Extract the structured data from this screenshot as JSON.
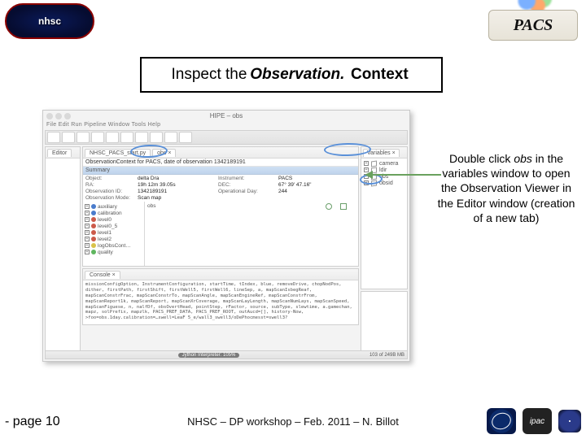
{
  "header": {
    "nhsc": "nhsc",
    "pacs": "PACS"
  },
  "title": {
    "pre": "Inspect the ",
    "em1": "Observation.",
    "em2": "Context"
  },
  "callout": {
    "l1": "Double click ",
    "obs": "obs",
    "l2": " in the variables window to open the Observation Viewer in the Editor window (creation of a new tab)"
  },
  "app": {
    "window_title": "HIPE – obs",
    "menubar": "File  Edit  Run  Pipeline  Window  Tools  Help",
    "left_tab": "Editor",
    "tabs": {
      "a": "NHSC_PACS_start.py",
      "b": "obs ×"
    },
    "summary_hdr": "Summary",
    "obs_title": "ObservationContext for PACS, date of observation 1342189191",
    "fields": {
      "obj_k": "Object:",
      "obj_v": "delta Dra",
      "ra_k": "RA:",
      "ra_v": "19h 12m 39.05s",
      "obsid_k": "Observation ID:",
      "obsid_v": "1342189191",
      "mode_k": "Observation Mode:",
      "mode_v": "Scan map",
      "inst_k": "Instrument:",
      "inst_v": "PACS",
      "dec_k": "DEC:",
      "dec_v": "67° 39' 47.16\"",
      "od_k": "Operational Day:",
      "od_v": "244"
    },
    "tree": {
      "a": "auxiliary",
      "b": "calibration",
      "c": "level0",
      "d": "level0_5",
      "e": "level1",
      "f": "level2",
      "g": "logObsCont…",
      "h": "quality"
    },
    "preview_label": "obs",
    "variables_tab": "Variables ×",
    "vars": {
      "a": "camera",
      "b": "ldir",
      "c": "obs",
      "d": "obsid"
    },
    "console_tab": "Console ×",
    "console_text": "missionConfigOption, InstrumentConfiguration, startTime, tIndex, blue,\\nremoveDrive, chopNodPos, dither, firstPath, firstShift, firstWell5, firstWell6,\\nlineSep, a, mapScanIsbegReaf, mapScanConstrFrac, mapScanConstrTo,\\nmapScanAngle, mapScanEngineRef, mapScanConstrFrom, mapScanReport1k, mapScanReport,\\nmapScanXrCoverage, mapScanLayLength, mapScanNumLays, mapScanSpeed, mapScanFiguese,\\nn, nalfDf, obsOvertHead, pointStep, rFactor, source, subType, slewtime,\\na.gamechan, mapz, solPrefix, mapzlk, PACS_PREF_DATA, PACS_PREF_ROOT,\\noutAucd=[], history-Now,\\n>foo=obs.1day.calibration=…swell=LeaF 5_e/wall3_swell3/oDePhocmesst=swell3?",
    "status_mid": "Jython Interpreter: 105%",
    "status_right": "103 of 249B MB"
  },
  "footer": {
    "page_pre": "- page ",
    "page_num": "10",
    "credit": "NHSC – DP workshop – Feb. 2011 – N. Billot",
    "ipac": "ipac"
  }
}
